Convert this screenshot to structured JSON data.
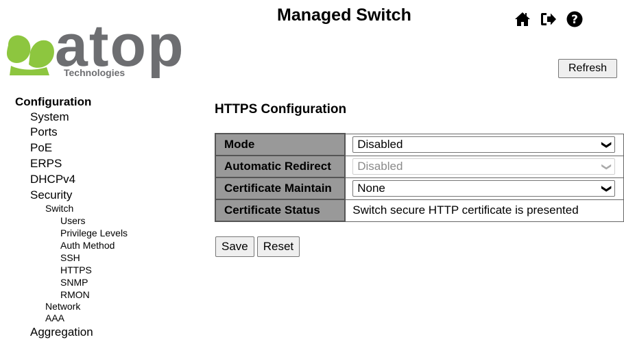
{
  "header": {
    "logo_text": "atop",
    "logo_subtitle": "Technologies",
    "app_title": "Managed Switch",
    "icons": [
      "home-icon",
      "logout-icon",
      "help-icon"
    ],
    "refresh_label": "Refresh"
  },
  "sidebar": {
    "title": "Configuration",
    "items": [
      {
        "label": "System",
        "level": 1
      },
      {
        "label": "Ports",
        "level": 1
      },
      {
        "label": "PoE",
        "level": 1
      },
      {
        "label": "ERPS",
        "level": 1
      },
      {
        "label": "DHCPv4",
        "level": 1
      },
      {
        "label": "Security",
        "level": 1
      },
      {
        "label": "Switch",
        "level": 2
      },
      {
        "label": "Users",
        "level": 3
      },
      {
        "label": "Privilege Levels",
        "level": 3
      },
      {
        "label": "Auth Method",
        "level": 3
      },
      {
        "label": "SSH",
        "level": 3
      },
      {
        "label": "HTTPS",
        "level": 3
      },
      {
        "label": "SNMP",
        "level": 3
      },
      {
        "label": "RMON",
        "level": 3
      },
      {
        "label": "Network",
        "level": 2
      },
      {
        "label": "AAA",
        "level": 2
      },
      {
        "label": "Aggregation",
        "level": 1
      }
    ]
  },
  "main": {
    "title": "HTTPS Configuration",
    "rows": {
      "mode": {
        "label": "Mode",
        "value": "Disabled"
      },
      "automatic_redirect": {
        "label": "Automatic Redirect",
        "value": "Disabled"
      },
      "certificate_maintain": {
        "label": "Certificate Maintain",
        "value": "None"
      },
      "certificate_status": {
        "label": "Certificate Status",
        "value": "Switch secure HTTP certificate is presented"
      }
    },
    "save_label": "Save",
    "reset_label": "Reset"
  },
  "colors": {
    "logo_green": "#8dc63f",
    "logo_gray": "#6d6e71",
    "table_header_bg": "#999999"
  }
}
